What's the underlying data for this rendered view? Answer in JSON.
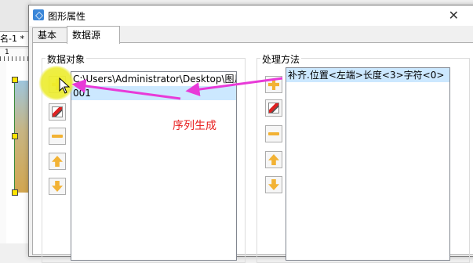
{
  "background": {
    "tab_label": "名-1 *",
    "ruler_number": "1"
  },
  "dialog": {
    "title": "图形属性",
    "close": "✕"
  },
  "tabs": [
    {
      "label": "基本"
    },
    {
      "label": "数据源"
    }
  ],
  "left_group": {
    "label": "数据对象",
    "items": [
      {
        "text": "C:\\Users\\Administrator\\Desktop\\图片\\M"
      },
      {
        "text": "001"
      }
    ]
  },
  "right_group": {
    "label": "处理方法",
    "items": [
      {
        "text": "补齐.位置<左端>长度<3>字符<0>"
      }
    ]
  },
  "buttons": [
    {
      "icon": "add-icon"
    },
    {
      "icon": "edit-icon"
    },
    {
      "icon": "remove-icon"
    },
    {
      "icon": "move-up-icon"
    },
    {
      "icon": "move-down-icon"
    }
  ],
  "annotation": {
    "text": "序列生成",
    "color": "#e82020"
  },
  "colors": {
    "selection": "#cce8ff",
    "arrow": "#e83ad8",
    "highlight": "#f0f028"
  }
}
